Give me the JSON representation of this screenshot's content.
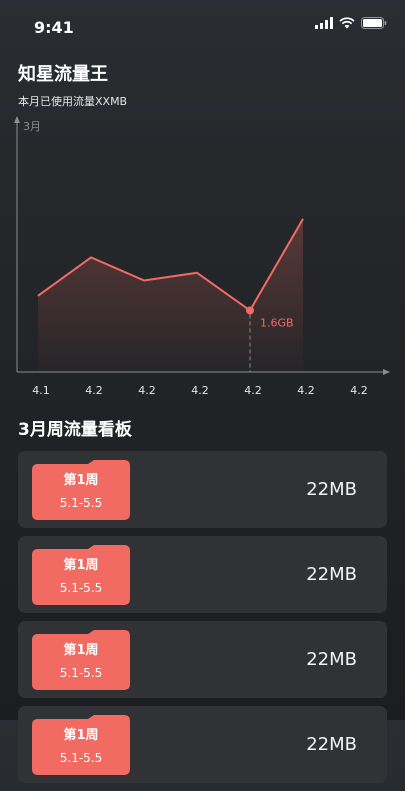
{
  "status_bar": {
    "time": "9:41"
  },
  "app": {
    "title": "知星流量王",
    "subtitle": "本月已使用流量XXMB"
  },
  "colors": {
    "accent": "#f26b63",
    "card": "#303236",
    "background": "#232528"
  },
  "chart_data": {
    "type": "area",
    "ylabel": "3月",
    "x": [
      "4.1",
      "4.2",
      "4.2",
      "4.2",
      "4.2",
      "4.2",
      "4.2"
    ],
    "series": [
      {
        "values": [
          1.98,
          2.98,
          2.38,
          2.58,
          1.6,
          3.98
        ]
      }
    ],
    "annotation": {
      "index": 4,
      "label": "1.6GB"
    },
    "ylim": [
      0,
      6.5
    ],
    "grid": false
  },
  "section": {
    "title": "3月周流量看板"
  },
  "weeks": [
    {
      "label": "第1周",
      "range": "5.1-5.5",
      "usage": "22MB"
    },
    {
      "label": "第1周",
      "range": "5.1-5.5",
      "usage": "22MB"
    },
    {
      "label": "第1周",
      "range": "5.1-5.5",
      "usage": "22MB"
    },
    {
      "label": "第1周",
      "range": "5.1-5.5",
      "usage": "22MB"
    }
  ]
}
